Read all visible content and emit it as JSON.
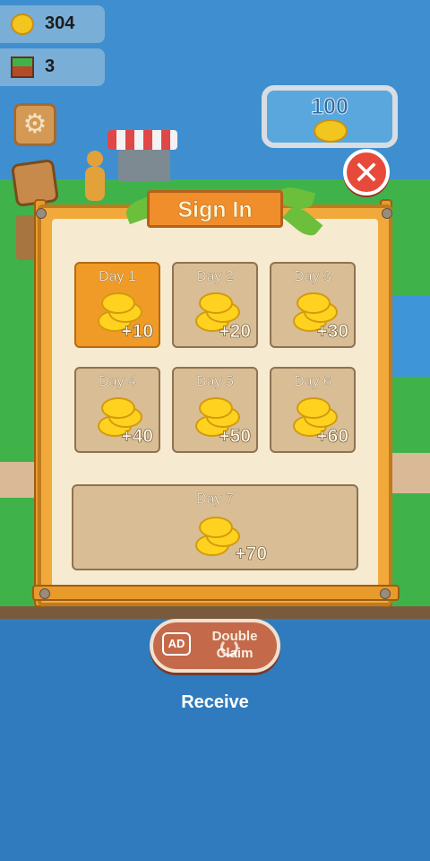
{
  "hud": {
    "coins": "304",
    "blocks": "3"
  },
  "map": {
    "target_value": "100"
  },
  "dialog": {
    "title": "Sign In",
    "days": [
      {
        "label": "Day 1",
        "amount": "+10",
        "active": true
      },
      {
        "label": "Day 2",
        "amount": "+20",
        "active": false
      },
      {
        "label": "Day 3",
        "amount": "+30",
        "active": false
      },
      {
        "label": "Day 4",
        "amount": "+40",
        "active": false
      },
      {
        "label": "Day 5",
        "amount": "+50",
        "active": false
      },
      {
        "label": "Day 6",
        "amount": "+60",
        "active": false
      },
      {
        "label": "Day 7",
        "amount": "+70",
        "active": false
      }
    ]
  },
  "actions": {
    "ad_badge": "AD",
    "double_claim": "Double Claim",
    "receive": "Receive"
  },
  "icons": {
    "coin": "coin-icon",
    "block": "grass-block-icon",
    "settings": "gear-icon",
    "close": "close-icon"
  },
  "colors": {
    "active_day": "#f09b27",
    "inactive_day": "#d8bd95",
    "close_button": "#e74a3b"
  }
}
